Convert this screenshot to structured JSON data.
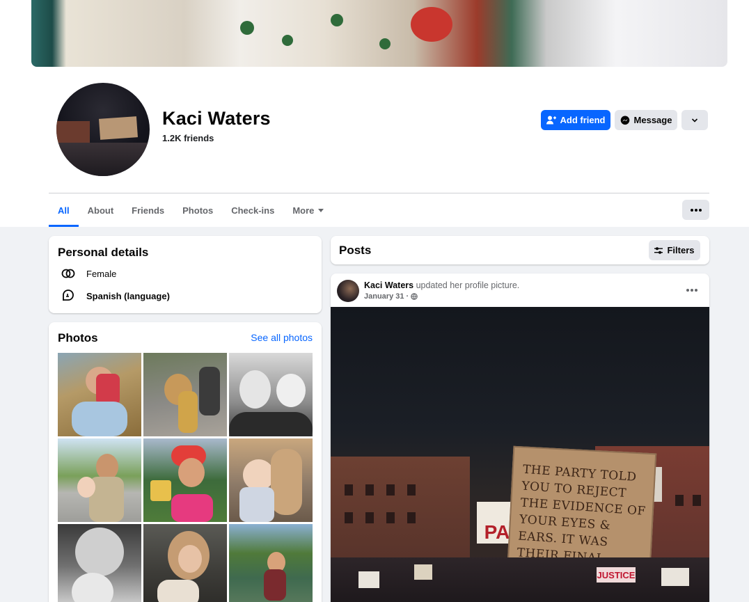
{
  "profile": {
    "name": "Kaci Waters",
    "friends_count": "1.2K friends"
  },
  "actions": {
    "add_friend": "Add friend",
    "message": "Message"
  },
  "tabs": [
    {
      "label": "All",
      "active": true
    },
    {
      "label": "About",
      "active": false
    },
    {
      "label": "Friends",
      "active": false
    },
    {
      "label": "Photos",
      "active": false
    },
    {
      "label": "Check-ins",
      "active": false
    },
    {
      "label": "More",
      "active": false
    }
  ],
  "personal_details": {
    "title": "Personal details",
    "items": [
      {
        "icon": "gender-icon",
        "text": "Female"
      },
      {
        "icon": "language-icon",
        "text": "Spanish (language)"
      }
    ]
  },
  "photos": {
    "title": "Photos",
    "see_all": "See all photos"
  },
  "posts": {
    "title": "Posts",
    "filters_label": "Filters",
    "items": [
      {
        "author": "Kaci Waters",
        "action": "updated her profile picture.",
        "date": "January 31",
        "privacy_icon": "globe-icon",
        "image_sign_text": "THE PARTY TOLD YOU TO REJECT THE EVIDENCE OF YOUR EYES & EARS. IT WAS THEIR FINAL, MOST ESSENTIAL COMMAND.",
        "image_small_signs": [
          "PA",
          "JUSTICE"
        ]
      }
    ]
  },
  "colors": {
    "accent": "#0866ff",
    "secondary_button": "#e4e6eb",
    "page_bg": "#f0f2f5",
    "muted_text": "#65676b"
  }
}
